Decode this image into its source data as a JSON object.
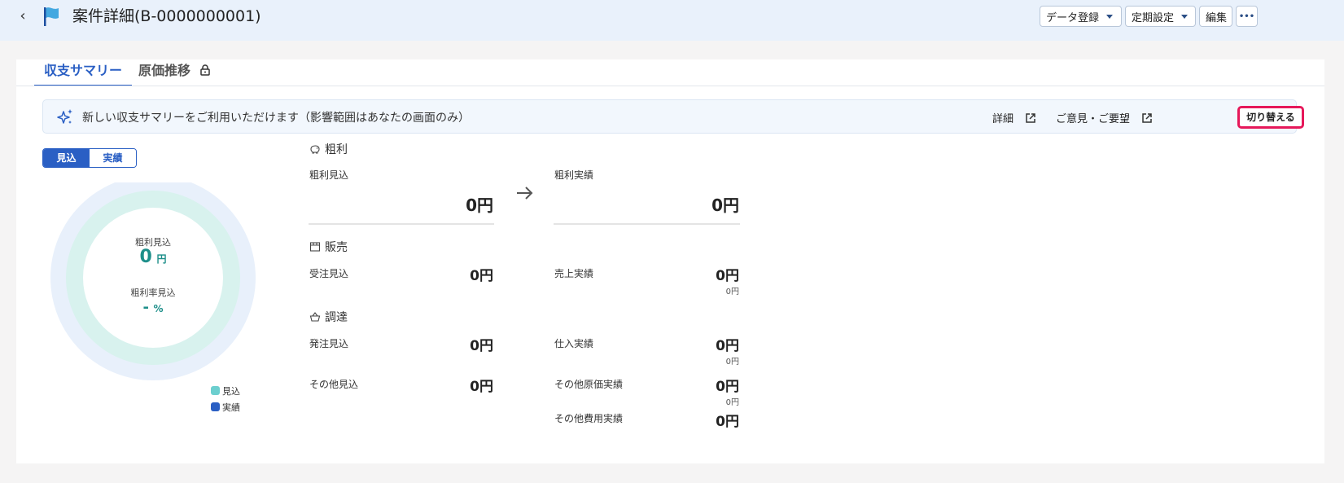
{
  "header": {
    "title": "案件詳細(B-0000000001)",
    "buttons": {
      "data_register": "データ登録",
      "periodic": "定期設定",
      "edit": "編集",
      "more": "•••"
    },
    "back": "‹"
  },
  "tabs": [
    {
      "label": "収支サマリー",
      "active": true
    },
    {
      "label": "原価推移",
      "locked": true
    }
  ],
  "banner": {
    "text": "新しい収支サマリーをご利用いただけます（影響範囲はあなたの画面のみ）",
    "detail_link": "詳細",
    "feedback_link": "ご意見・ご要望",
    "switch_button": "切り替える"
  },
  "toggle": {
    "forecast": "見込",
    "actual": "実績"
  },
  "donut": {
    "profit_label": "粗利見込",
    "profit_value": "0",
    "profit_unit": "円",
    "rate_label": "粗利率見込",
    "rate_value": "-",
    "rate_unit": "%",
    "legend": [
      {
        "label": "見込",
        "color": "#6ccfcf"
      },
      {
        "label": "実績",
        "color": "#2a5fc4"
      }
    ]
  },
  "gross_profit": {
    "title": "粗利",
    "forecast_label": "粗利見込",
    "forecast_value": "0円",
    "actual_label": "粗利実績",
    "actual_value": "0円"
  },
  "sales": {
    "title": "販売",
    "order_label": "受注見込",
    "order_value": "0円",
    "revenue_label": "売上実績",
    "revenue_value": "0円",
    "revenue_sub": "0円"
  },
  "procurement": {
    "title": "調達",
    "purchase_order_label": "発注見込",
    "purchase_order_value": "0円",
    "purchase_label": "仕入実績",
    "purchase_value": "0円",
    "purchase_sub": "0円",
    "other_forecast_label": "その他見込",
    "other_forecast_value": "0円",
    "other_cost_label": "その他原価実績",
    "other_cost_value": "0円",
    "other_cost_sub": "0円",
    "other_expense_label": "その他費用実績",
    "other_expense_value": "0円"
  },
  "colors": {
    "accent": "#2a5fc4",
    "teal": "#1e8f8a",
    "highlight": "#e6185a",
    "header_bg": "#e9f1fb"
  }
}
